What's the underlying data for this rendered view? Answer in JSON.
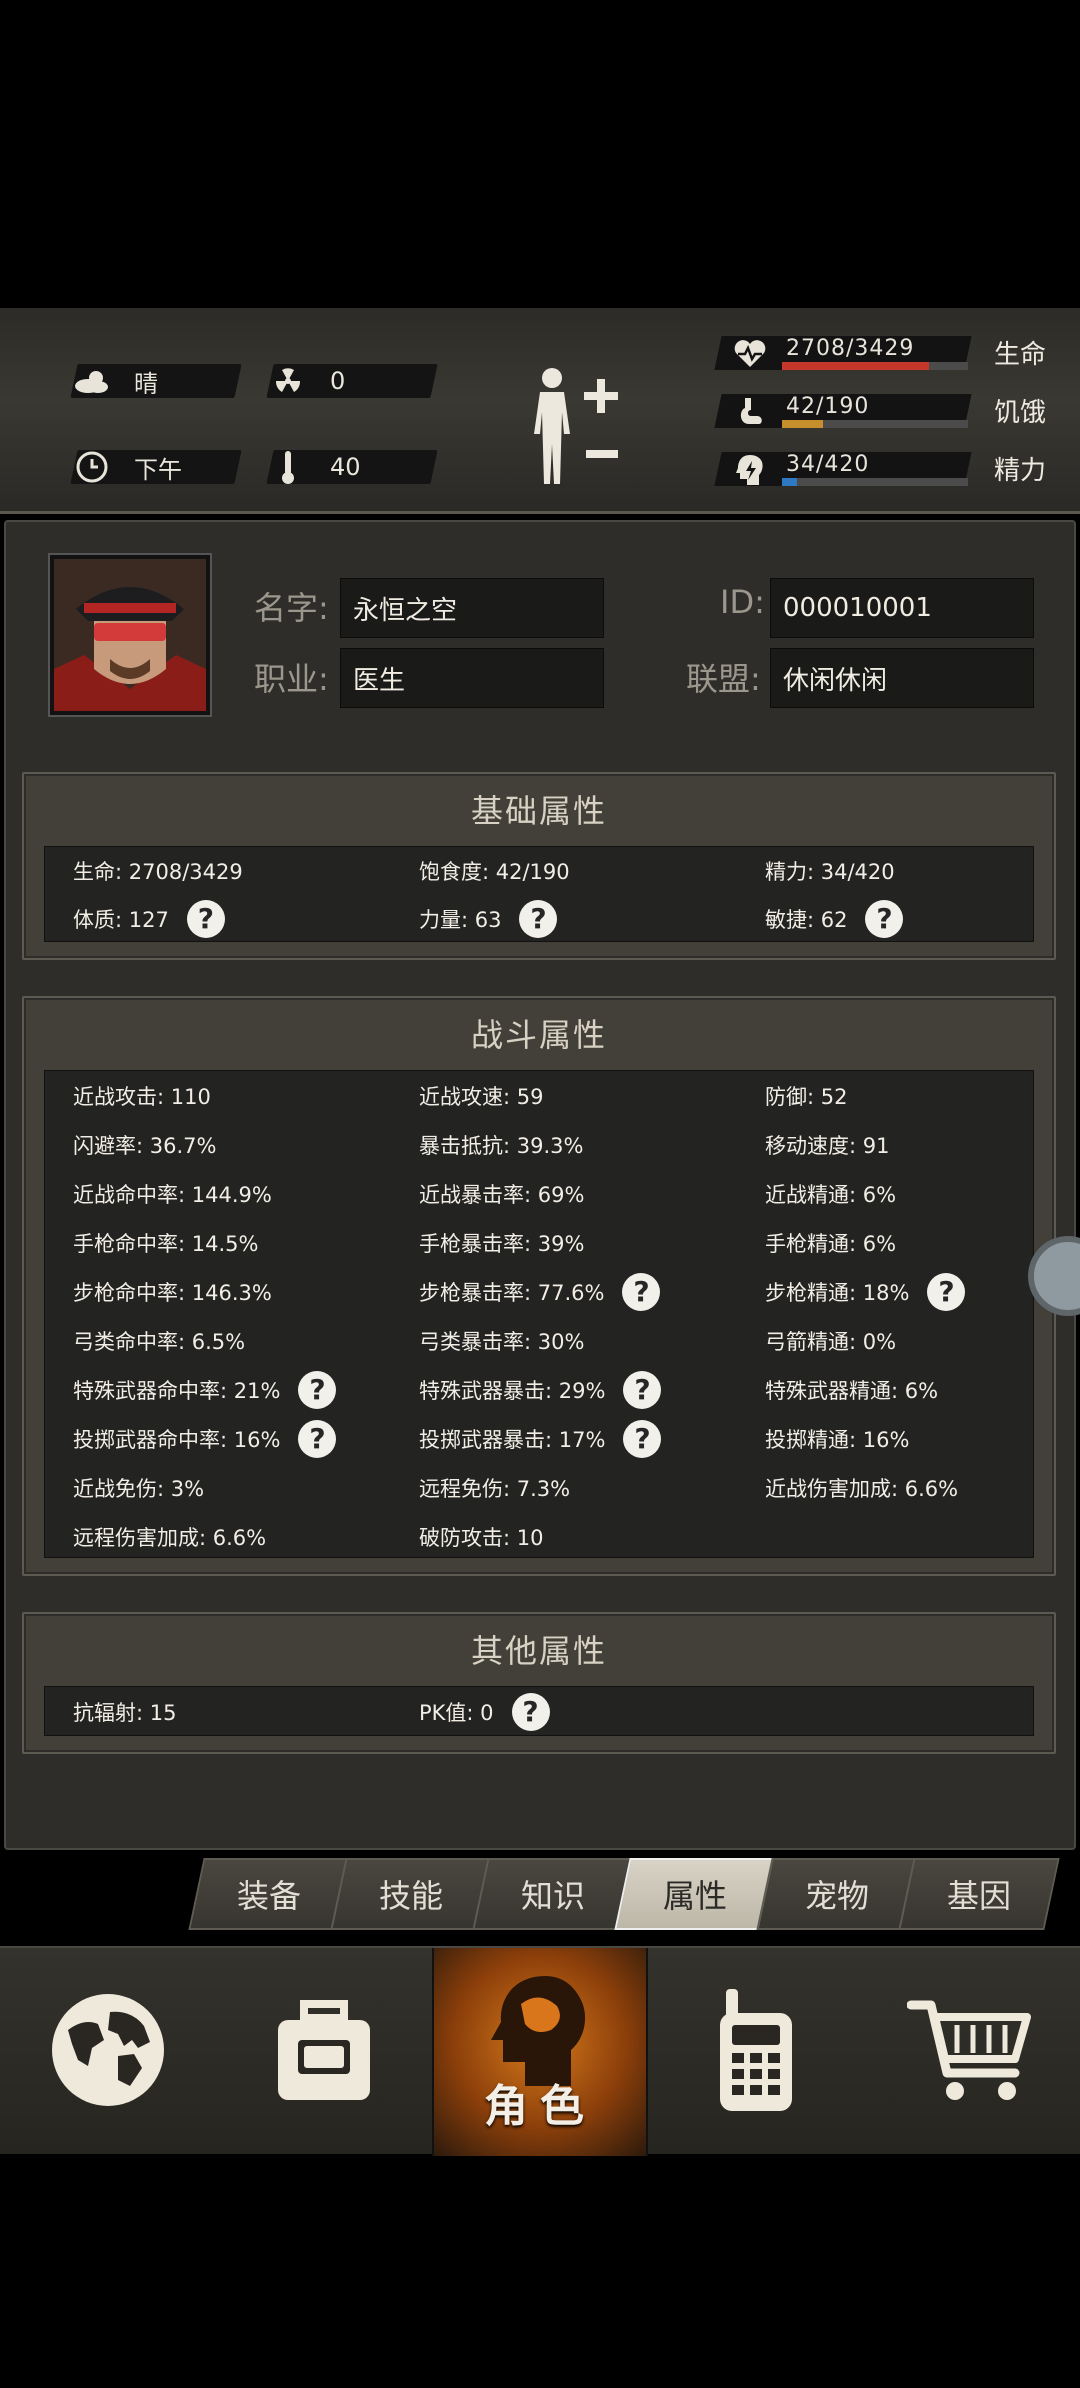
{
  "status": {
    "weather": "晴",
    "radiation": "0",
    "time_of_day": "下午",
    "temperature": "40",
    "life": {
      "value": "2708/3429",
      "label": "生命",
      "fraction": 0.79,
      "color": "#c5372b"
    },
    "hunger": {
      "value": "42/190",
      "label": "饥饿",
      "fraction": 0.22,
      "color": "#c78f2c"
    },
    "energy": {
      "value": "34/420",
      "label": "精力",
      "fraction": 0.08,
      "color": "#2f79c4"
    }
  },
  "profile": {
    "name_label": "名字:",
    "name": "永恒之空",
    "id_label": "ID:",
    "id": "000010001",
    "job_label": "职业:",
    "job": "医生",
    "alliance_label": "联盟:",
    "alliance": "休闲休闲"
  },
  "basic": {
    "title": "基础属性",
    "rows": [
      [
        "生命: 2708/3429",
        "饱食度: 42/190",
        "精力: 34/420"
      ],
      [
        "体质: 127",
        "力量: 63",
        "敏捷: 62"
      ]
    ]
  },
  "combat": {
    "title": "战斗属性",
    "rows": [
      [
        "近战攻击: 110",
        "近战攻速: 59",
        "防御: 52"
      ],
      [
        "闪避率: 36.7%",
        "暴击抵抗: 39.3%",
        "移动速度: 91"
      ],
      [
        "近战命中率: 144.9%",
        "近战暴击率: 69%",
        "近战精通: 6%"
      ],
      [
        "手枪命中率: 14.5%",
        "手枪暴击率: 39%",
        "手枪精通: 6%"
      ],
      [
        "步枪命中率: 146.3%",
        "步枪暴击率: 77.6%",
        "步枪精通: 18%"
      ],
      [
        "弓类命中率: 6.5%",
        "弓类暴击率: 30%",
        "弓箭精通: 0%"
      ],
      [
        "特殊武器命中率: 21%",
        "特殊武器暴击: 29%",
        "特殊武器精通: 6%"
      ],
      [
        "投掷武器命中率: 16%",
        "投掷武器暴击: 17%",
        "投掷精通: 16%"
      ],
      [
        "近战免伤: 3%",
        "远程免伤: 7.3%",
        "近战伤害加成: 6.6%"
      ],
      [
        "远程伤害加成: 6.6%",
        "破防攻击: 10",
        ""
      ]
    ]
  },
  "other": {
    "title": "其他属性",
    "rows": [
      [
        "抗辐射: 15",
        "PK值: 0",
        ""
      ]
    ]
  },
  "help_glyph": "?",
  "tabs": [
    "装备",
    "技能",
    "知识",
    "属性",
    "宠物",
    "基因"
  ],
  "active_tab": "属性",
  "nav": {
    "items": [
      "world-map",
      "backpack",
      "character",
      "radio",
      "shop"
    ],
    "active_label": "角色"
  }
}
